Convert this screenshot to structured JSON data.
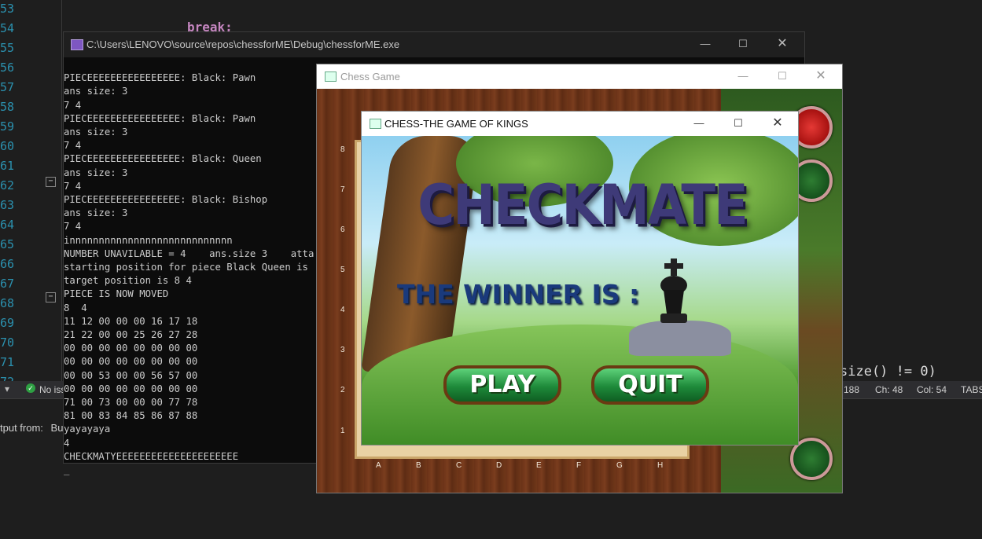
{
  "ide": {
    "line_numbers": [
      "53",
      "54",
      "55",
      "56",
      "57",
      "58",
      "59",
      "60",
      "61",
      "62",
      "63",
      "64",
      "65",
      "66",
      "67",
      "68",
      "69",
      "70",
      "71",
      "72"
    ],
    "code_top": "break;",
    "code_right": "size() != 0)",
    "status": {
      "issues": "No iss",
      "line": "188",
      "ch": "Ch: 48",
      "col": "Col: 54",
      "tabs": "TABS"
    },
    "output_label": "tput from:",
    "output_source": "Bu"
  },
  "console": {
    "title": "C:\\Users\\LENOVO\\source\\repos\\chessforME\\Debug\\chessforME.exe",
    "lines": [
      "PIECEEEEEEEEEEEEEEEE: Black: Pawn",
      "ans size: 3",
      "7 4",
      "PIECEEEEEEEEEEEEEEEE: Black: Pawn",
      "ans size: 3",
      "7 4",
      "PIECEEEEEEEEEEEEEEEE: Black: Queen",
      "ans size: 3",
      "7 4",
      "PIECEEEEEEEEEEEEEEEE: Black: Bishop",
      "ans size: 3",
      "7 4",
      "innnnnnnnnnnnnnnnnnnnnnnnnnnn",
      "NUMBER UNAVILABLE = 4    ans.size 3    atta",
      "starting position for piece Black Queen is",
      "target position is 8 4",
      "PIECE IS NOW MOVED",
      "8  4",
      "11 12 00 00 00 16 17 18",
      "21 22 00 00 25 26 27 28",
      "00 00 00 00 00 00 00 00",
      "00 00 00 00 00 00 00 00",
      "00 00 53 00 00 56 57 00",
      "00 00 00 00 00 00 00 00",
      "71 00 73 00 00 00 77 78",
      "81 00 83 84 85 86 87 88",
      "yayayaya",
      "4",
      "CHECKMATYEEEEEEEEEEEEEEEEEEEEE",
      "_"
    ]
  },
  "chess_window": {
    "title": "Chess Game",
    "ranks": [
      "8",
      "7",
      "6",
      "5",
      "4",
      "3",
      "2",
      "1"
    ],
    "files": [
      "A",
      "B",
      "C",
      "D",
      "E",
      "F",
      "G",
      "H"
    ]
  },
  "dialog": {
    "title": "CHESS-THE GAME OF KINGS",
    "headline": "CHECKMATE",
    "winner_text": "THE WINNER IS :",
    "play_label": "PLAY",
    "quit_label": "QUIT"
  },
  "window_controls": {
    "minimize": "—",
    "maximize": "☐",
    "close": "✕"
  }
}
